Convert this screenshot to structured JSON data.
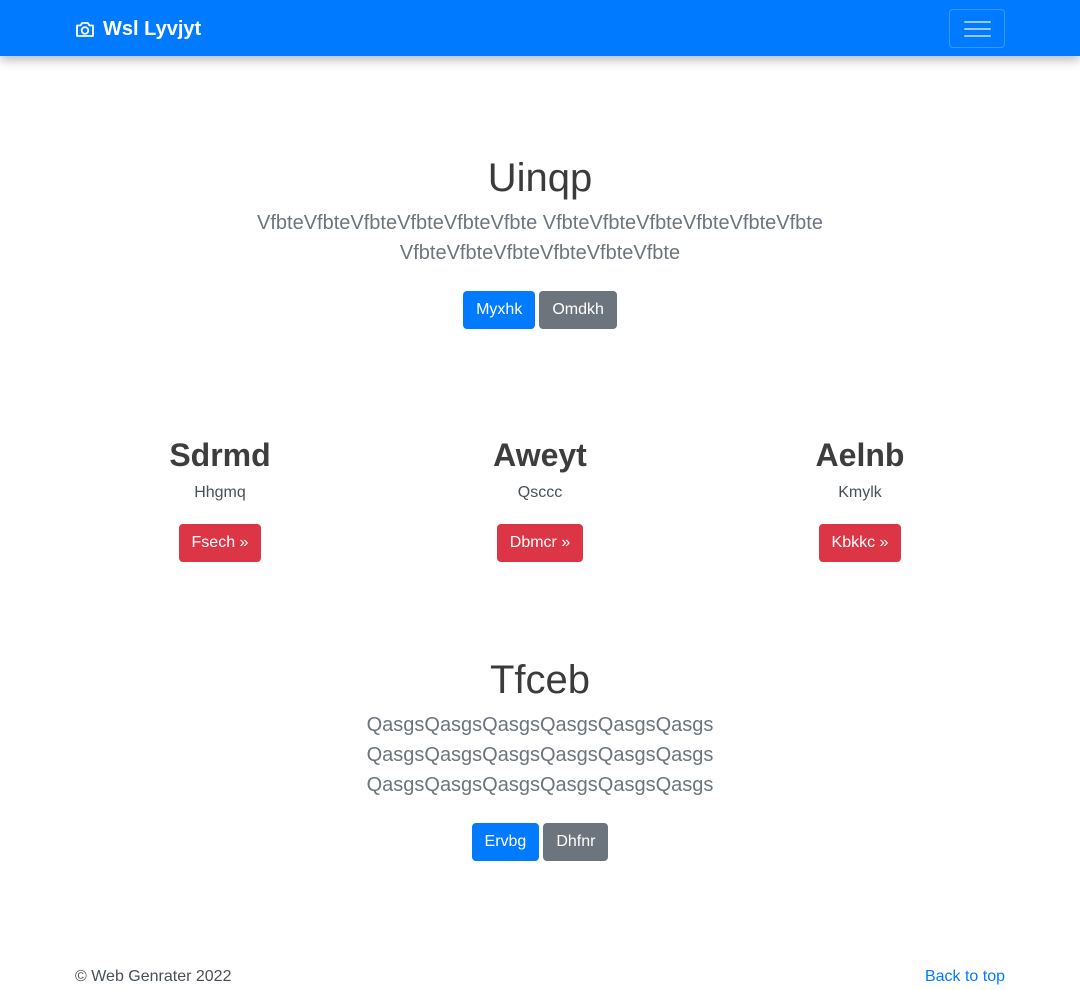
{
  "navbar": {
    "brand_label": "Wsl Lyvjyt",
    "brand_icon": "camera-icon",
    "toggler_icon": "hamburger-icon",
    "color": "#007bff"
  },
  "hero1": {
    "title": "Uinqp",
    "lead_line1": "VfbteVfbteVfbteVfbteVfbteVfbte VfbteVfbteVfbteVfbteVfbteVfbte",
    "lead_line2": "VfbteVfbteVfbteVfbteVfbteVfbte",
    "primary_button": "Myxhk",
    "secondary_button": "Omdkh"
  },
  "columns": [
    {
      "heading": "Sdrmd",
      "text": "Hhgmq",
      "button": "Fsech »"
    },
    {
      "heading": "Aweyt",
      "text": "Qsccc",
      "button": "Dbmcr »"
    },
    {
      "heading": "Aelnb",
      "text": "Kmylk",
      "button": "Kbkkc »"
    }
  ],
  "hero2": {
    "title": "Tfceb",
    "lead_line1": "QasgsQasgsQasgsQasgsQasgsQasgs",
    "lead_line2": "QasgsQasgsQasgsQasgsQasgsQasgs",
    "lead_line3": "QasgsQasgsQasgsQasgsQasgsQasgs",
    "primary_button": "Ervbg",
    "secondary_button": "Dhfnr"
  },
  "footer": {
    "copyright": "© Web Genrater 2022",
    "back_to_top": "Back to top"
  },
  "colors": {
    "primary": "#007bff",
    "secondary": "#6c757d",
    "danger": "#dc3545"
  }
}
